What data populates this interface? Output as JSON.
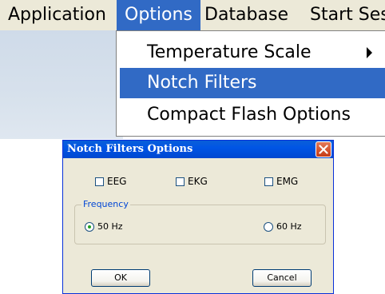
{
  "menubar": {
    "items": [
      "Application",
      "Options",
      "Database",
      "Start Ses"
    ],
    "active_index": 1
  },
  "options_menu": {
    "items": [
      {
        "label": "Temperature Scale",
        "has_submenu": true
      },
      {
        "label": "Notch Filters",
        "highlighted": true
      },
      {
        "label": "Compact Flash Options"
      }
    ]
  },
  "dialog": {
    "title": "Notch Filters Options",
    "close_icon": "close-icon",
    "checkboxes": [
      {
        "label": "EEG",
        "checked": false
      },
      {
        "label": "EKG",
        "checked": false
      },
      {
        "label": "EMG",
        "checked": false
      }
    ],
    "frequency": {
      "legend": "Frequency",
      "options": [
        {
          "label": "50 Hz",
          "selected": true
        },
        {
          "label": "60 Hz",
          "selected": false
        }
      ]
    },
    "buttons": {
      "ok": "OK",
      "cancel": "Cancel"
    }
  },
  "colors": {
    "highlight": "#316ac5",
    "titlebar": "#0055e5",
    "dialog_bg": "#ece9d8",
    "group_legend": "#0046d5",
    "radio_dot": "#21a121"
  }
}
